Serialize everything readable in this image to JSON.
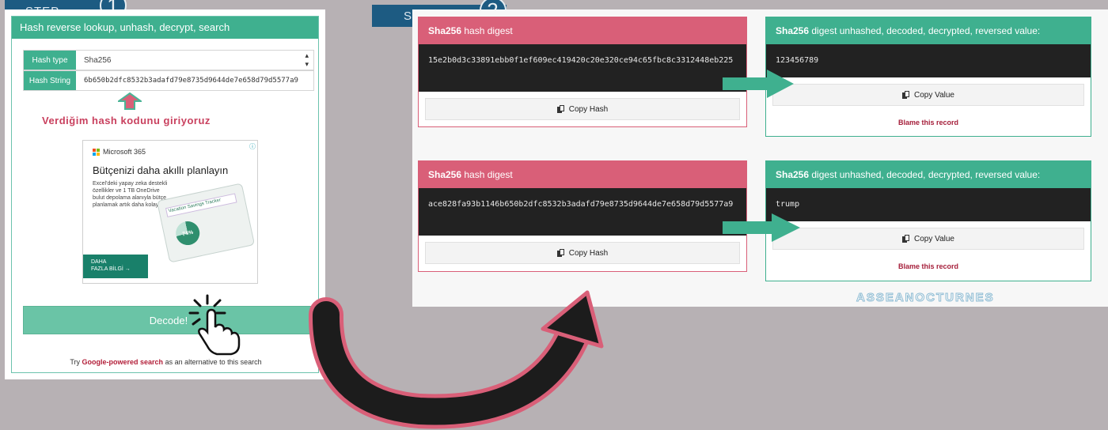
{
  "steps": [
    {
      "label": "STEP",
      "number": "1"
    },
    {
      "label": "STEP",
      "number": "2"
    }
  ],
  "left_panel": {
    "header": "Hash reverse lookup, unhash, decrypt, search",
    "hash_type_label": "Hash type",
    "hash_type_value": "Sha256",
    "hash_string_label": "Hash String",
    "hash_string_value": "6b650b2dfc8532b3adafd79e8735d9644de7e658d79d5577a9",
    "annotation": "Verdiğim hash kodunu giriyoruz",
    "decode_button": "Decode!",
    "alt_text_pre": "Try",
    "alt_link": "Google-powered search",
    "alt_text_post": "as an alternative to this search"
  },
  "ad": {
    "brand": "Microsoft 365",
    "title": "Bütçenizi daha akıllı planlayın",
    "body": "Excel'deki yapay zeka destekli özellikler ve 1 TB OneDrive bulut depolama alanıyla bütçe planlamak artık daha kolay",
    "device_caption": "Vacation Savings Tracker",
    "device_percent": "74%",
    "cta_line1": "DAHA",
    "cta_line2": "FAZLA BİLGİ →",
    "info_icon": "info-icon"
  },
  "results": [
    {
      "digest_title_bold": "Sha256",
      "digest_title_rest": "hash digest",
      "digest": "15e2b0d3c33891ebb0f1ef609ec419420c20e320ce94c65fbc8c3312448eb225",
      "copy_hash": "Copy Hash",
      "value_title_bold": "Sha256",
      "value_title_rest": "digest unhashed, decoded, decrypted, reversed value:",
      "value": "123456789",
      "copy_value": "Copy Value",
      "blame": "Blame this record"
    },
    {
      "digest_title_bold": "Sha256",
      "digest_title_rest": "hash digest",
      "digest": "ace828fa93b1146b650b2dfc8532b3adafd79e8735d9644de7e658d79d5577a9",
      "copy_hash": "Copy Hash",
      "value_title_bold": "Sha256",
      "value_title_rest": "digest unhashed, decoded, decrypted, reversed value:",
      "value": "trump",
      "copy_value": "Copy Value",
      "blame": "Blame this record"
    }
  ],
  "watermark": "ASSEANOCTURNES",
  "colors": {
    "teal": "#3fb08f",
    "red": "#d95f78",
    "navy": "#1d5b82",
    "arrow_pink": "#d95f78",
    "arrow_dark": "#1c1c1c"
  },
  "icons": [
    "copy-icon",
    "up-arrow-icon",
    "right-arrow-icon",
    "pointer-hand-icon",
    "curved-arrow-icon",
    "select-caret-icon"
  ]
}
